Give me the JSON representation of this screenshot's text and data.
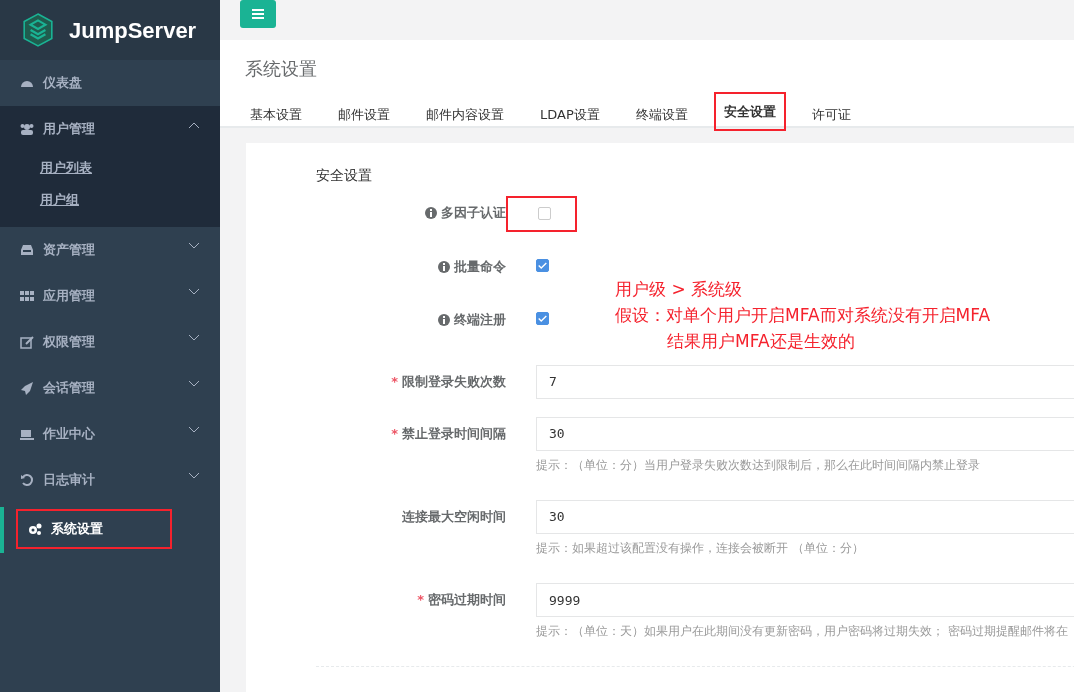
{
  "brand": {
    "name": "JumpServer"
  },
  "sidebar": {
    "items": [
      {
        "label": "仪表盘",
        "kind": "link",
        "expanded": false,
        "selected": false,
        "highlighted": false
      },
      {
        "label": "用户管理",
        "kind": "group",
        "expanded": true,
        "selected": false,
        "highlighted": false,
        "children": [
          {
            "label": "用户列表"
          },
          {
            "label": "用户组"
          }
        ]
      },
      {
        "label": "资产管理",
        "kind": "group",
        "expanded": false,
        "selected": false,
        "highlighted": false
      },
      {
        "label": "应用管理",
        "kind": "group",
        "expanded": false,
        "selected": false,
        "highlighted": false
      },
      {
        "label": "权限管理",
        "kind": "group",
        "expanded": false,
        "selected": false,
        "highlighted": false
      },
      {
        "label": "会话管理",
        "kind": "group",
        "expanded": false,
        "selected": false,
        "highlighted": false
      },
      {
        "label": "作业中心",
        "kind": "group",
        "expanded": false,
        "selected": false,
        "highlighted": false
      },
      {
        "label": "日志审计",
        "kind": "group",
        "expanded": false,
        "selected": false,
        "highlighted": false
      },
      {
        "label": "系统设置",
        "kind": "link",
        "expanded": false,
        "selected": true,
        "highlighted": true
      }
    ]
  },
  "page": {
    "title": "系统设置"
  },
  "tabs": [
    {
      "label": "基本设置",
      "selected": false,
      "highlighted": false
    },
    {
      "label": "邮件设置",
      "selected": false,
      "highlighted": false
    },
    {
      "label": "邮件内容设置",
      "selected": false,
      "highlighted": false
    },
    {
      "label": "LDAP设置",
      "selected": false,
      "highlighted": false
    },
    {
      "label": "终端设置",
      "selected": false,
      "highlighted": false
    },
    {
      "label": "安全设置",
      "selected": true,
      "highlighted": true
    },
    {
      "label": "许可证",
      "selected": false,
      "highlighted": false
    }
  ],
  "form": {
    "section_title": "安全设置",
    "fields": [
      {
        "kind": "checkbox",
        "label": "多因子认证",
        "info": true,
        "checked": false,
        "highlighted": true
      },
      {
        "kind": "checkbox",
        "label": "批量命令",
        "info": true,
        "checked": true,
        "highlighted": false
      },
      {
        "kind": "checkbox",
        "label": "终端注册",
        "info": true,
        "checked": true,
        "highlighted": false
      },
      {
        "kind": "input",
        "label": "限制登录失败次数",
        "info": false,
        "required_mark": "*",
        "value": "7",
        "highlighted": false
      },
      {
        "kind": "input",
        "label": "禁止登录时间间隔",
        "info": false,
        "required_mark": "*",
        "value": "30",
        "hint": "提示：（单位：分）当用户登录失败次数达到限制后，那么在此时间间隔内禁止登录",
        "highlighted": false
      },
      {
        "kind": "input",
        "label": "连接最大空闲时间",
        "info": false,
        "value": "30",
        "hint": "提示：如果超过该配置没有操作，连接会被断开 （单位：分）",
        "highlighted": false
      },
      {
        "kind": "input",
        "label": "密码过期时间",
        "info": false,
        "required_mark": "*",
        "value": "9999",
        "hint": "提示：（单位：天）如果用户在此期间没有更新密码，用户密码将过期失效； 密码过期提醒邮件将在",
        "highlighted": false
      }
    ]
  },
  "annotation": {
    "lines": [
      "用户级 > 系统级",
      "假设：对单个用户开启MFA而对系统没有开启MFA",
      "结果用户MFA还是生效的"
    ]
  }
}
